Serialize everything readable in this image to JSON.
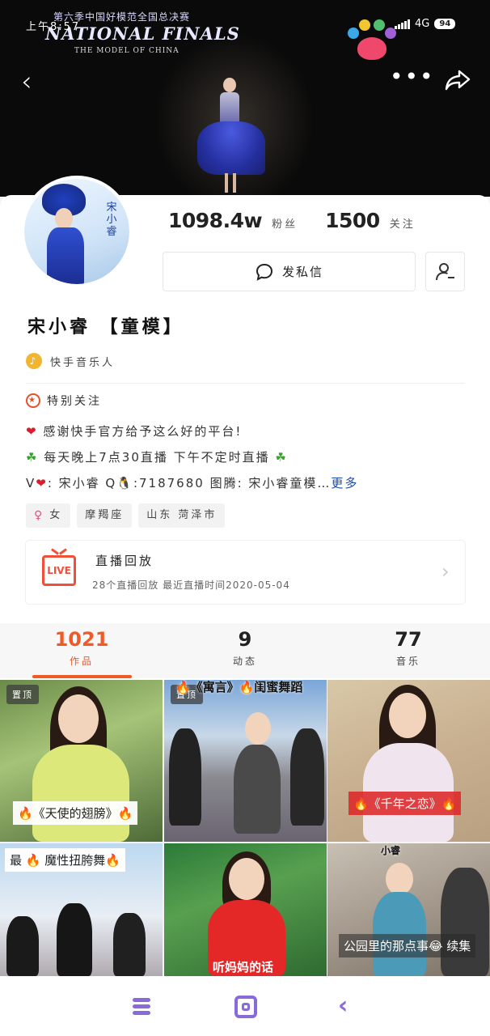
{
  "status_bar": {
    "left_text": "上午8:57",
    "network": "4G",
    "battery": "94"
  },
  "cover": {
    "event_cn": "第六季中国好模范全国总决赛",
    "event_en": "NATIONAL FINALS",
    "event_sub": "THE MODEL OF CHINA"
  },
  "profile": {
    "avatar_name": "宋小睿",
    "fans_count": "1098.4w",
    "fans_label": "粉丝",
    "following_count": "1500",
    "following_label": "关注",
    "message_button": "发私信",
    "nickname": "宋小睿 【童模】",
    "role": "快手音乐人",
    "special_label": "特别关注",
    "bio": [
      "感谢快手官方给予这么好的平台!",
      "每天晚上7点30直播  下午不定时直播",
      "V",
      ": 宋小睿    Q",
      ":7187680    图腾: 宋小睿童模…",
      "更多"
    ],
    "tags": [
      "女",
      "摩羯座",
      "山东 菏泽市"
    ]
  },
  "live_replay": {
    "title": "直播回放",
    "subtitle": "28个直播回放 最近直播时间2020-05-04",
    "icon_text": "LIVE"
  },
  "tabs": [
    {
      "count": "1021",
      "label": "作品"
    },
    {
      "count": "9",
      "label": "动态"
    },
    {
      "count": "77",
      "label": "音乐"
    }
  ],
  "videos": {
    "pin_label": "置顶",
    "captions": [
      "🔥《天使的翅膀》🔥",
      "🔥《寓言》🔥闺蜜舞蹈",
      "🔥《千年之恋》🔥",
      "最 🔥 魔性扭胯舞🔥",
      "听妈妈的话",
      "公园里的那点事😂 续集"
    ],
    "extra_text": "小睿"
  },
  "colors": {
    "accent": "#f05a28",
    "nav": "#8a6ad8",
    "link": "#1c4aa8"
  }
}
